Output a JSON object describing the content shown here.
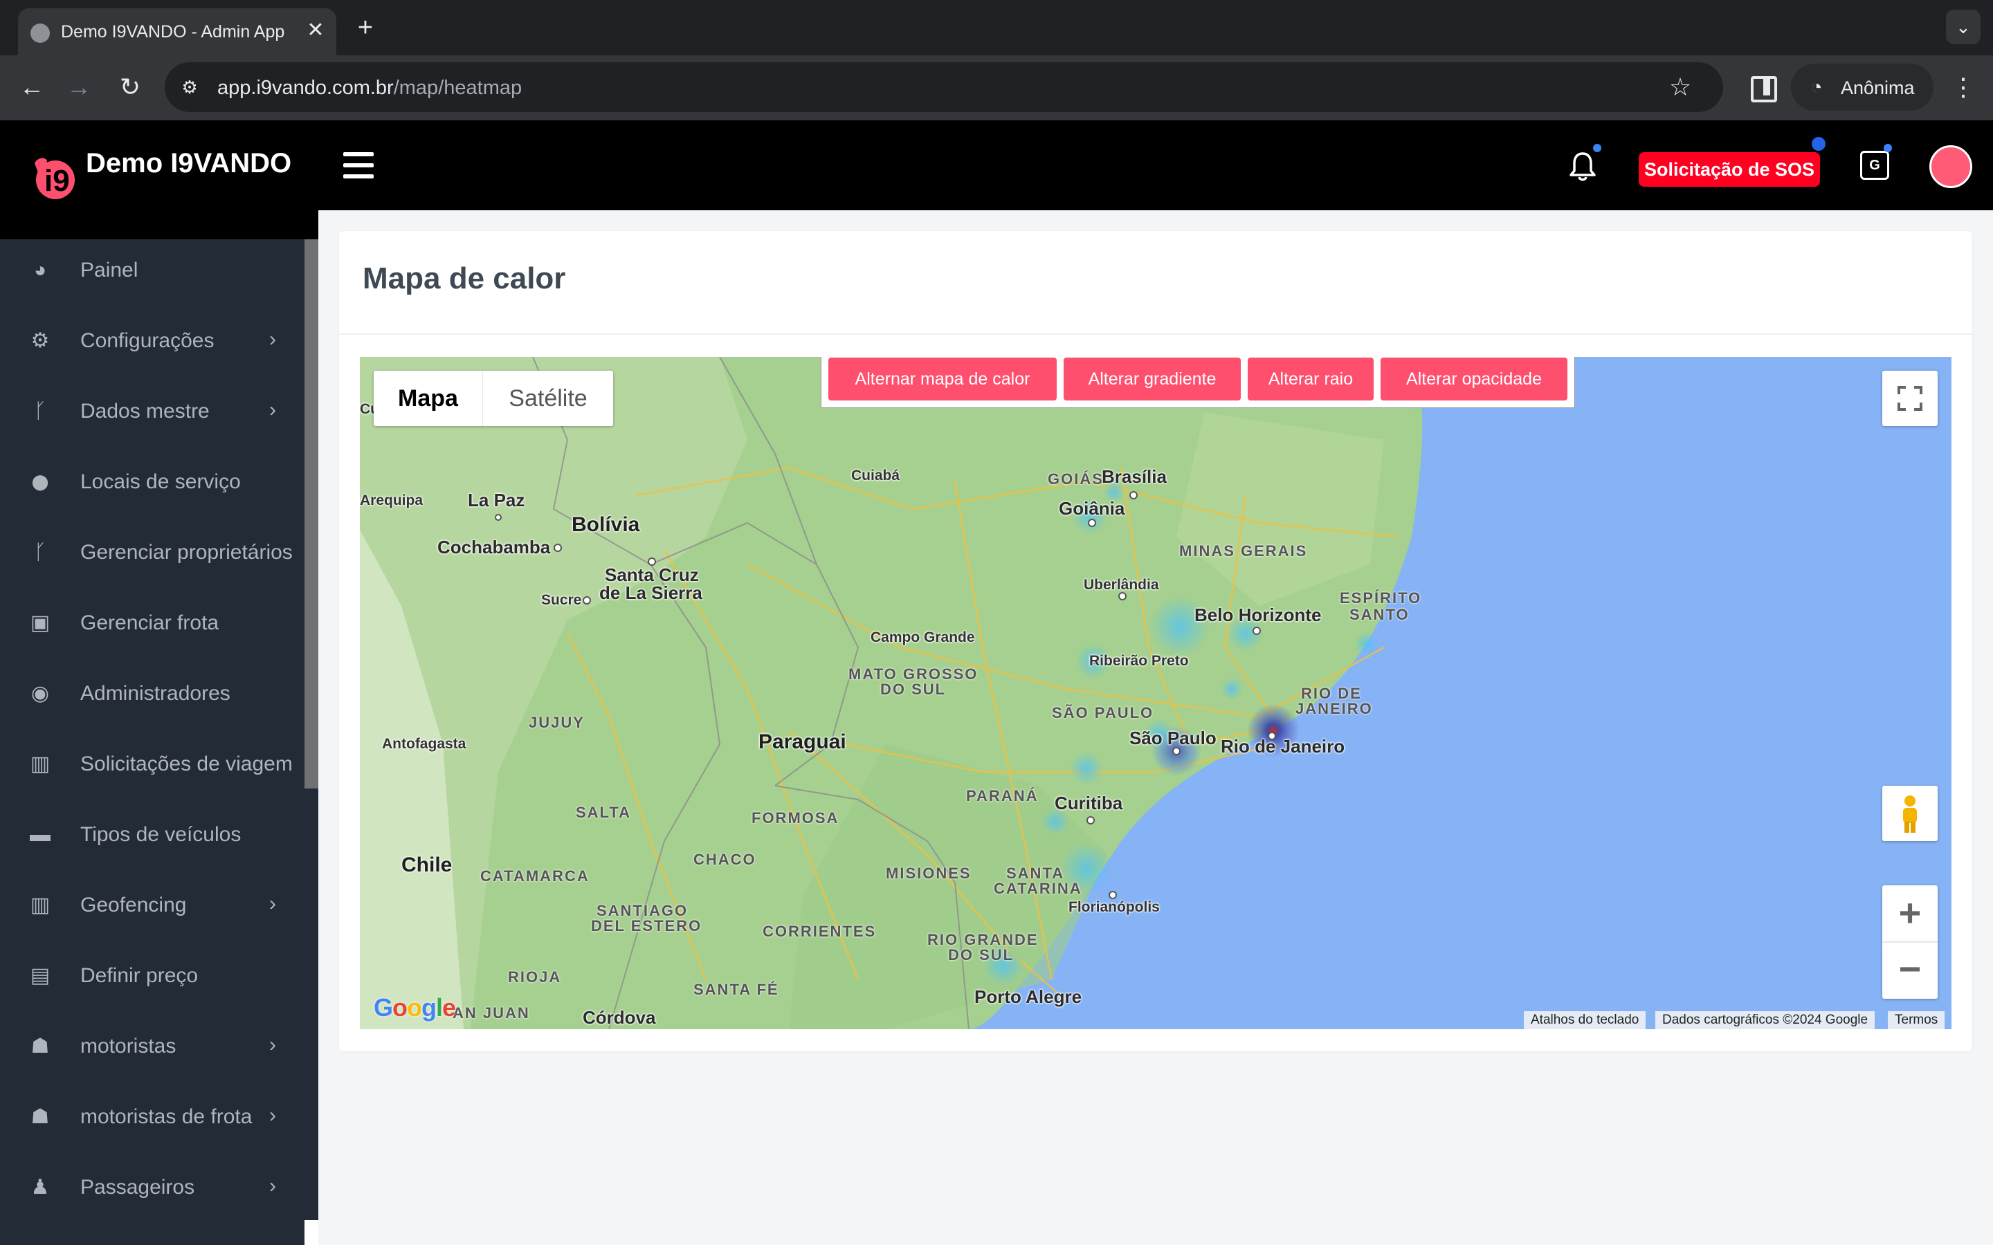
{
  "browser": {
    "tab_title": "Demo I9VANDO - Admin App",
    "tab_close": "✕",
    "new_tab": "+",
    "url_host": "app.i9vando.com.br",
    "url_path": "/map/heatmap",
    "profile_label": "Anônima",
    "tab_menu": "⌄"
  },
  "header": {
    "brand": "Demo I9VANDO",
    "sos_label": "Solicitação de SOS",
    "translate_glyph": "G",
    "accent_color": "#ff0021"
  },
  "sidebar": {
    "items": [
      {
        "label": "Painel",
        "icon": "dashboard-icon",
        "chevron": ""
      },
      {
        "label": "Configurações",
        "icon": "gears-icon",
        "chevron": "›"
      },
      {
        "label": "Dados mestre",
        "icon": "branch-icon",
        "chevron": "›"
      },
      {
        "label": "Locais de serviço",
        "icon": "map-pin-icon",
        "chevron": ""
      },
      {
        "label": "Gerenciar proprietários",
        "icon": "branch-icon",
        "chevron": ""
      },
      {
        "label": "Gerenciar frota",
        "icon": "bus-icon",
        "chevron": ""
      },
      {
        "label": "Administradores",
        "icon": "user-circle-icon",
        "chevron": ""
      },
      {
        "label": "Solicitações de viagem",
        "icon": "map-icon",
        "chevron": ""
      },
      {
        "label": "Tipos de veículos",
        "icon": "taxi-icon",
        "chevron": ""
      },
      {
        "label": "Geofencing",
        "icon": "map-icon",
        "chevron": "›"
      },
      {
        "label": "Definir preço",
        "icon": "money-icon",
        "chevron": ""
      },
      {
        "label": "motoristas",
        "icon": "users-icon",
        "chevron": "›"
      },
      {
        "label": "motoristas de frota",
        "icon": "users-icon",
        "chevron": "›"
      },
      {
        "label": "Passageiros",
        "icon": "user-icon",
        "chevron": "›"
      }
    ]
  },
  "page": {
    "title": "Mapa de calor"
  },
  "map": {
    "type_map": "Mapa",
    "type_satellite": "Satélite",
    "heat_buttons": [
      "Alternar mapa de calor",
      "Alterar gradiente",
      "Alterar raio",
      "Alterar opacidade"
    ],
    "zoom_in": "+",
    "zoom_out": "−",
    "attribution": {
      "shortcuts": "Atalhos do teclado",
      "data": "Dados cartográficos ©2024 Google",
      "terms": "Termos"
    },
    "labels": {
      "cu": "Cu",
      "arequipa": "Arequipa",
      "la_paz": "La Paz",
      "bolivia": "Bolívia",
      "cochabamba": "Cochabamba",
      "santa_cruz": "Santa Cruz",
      "de_la_sierra": "de La Sierra",
      "sucre": "Sucre",
      "cuiaba": "Cuiabá",
      "goias": "GOIÁS",
      "brasilia": "Brasília",
      "goiania": "Goiânia",
      "minas_gerais": "MINAS GERAIS",
      "uberlandia": "Uberlândia",
      "belo_horizonte": "Belo Horizonte",
      "espirito": "ESPÍRITO",
      "santo": "SANTO",
      "campo_grande": "Campo Grande",
      "mato_grosso": "MATO GROSSO",
      "do_sul": "DO SUL",
      "ribeirao": "Ribeirão Preto",
      "rio_de": "RIO DE",
      "janeiro_state": "JANEIRO",
      "sao_paulo_state": "SÃO PAULO",
      "antofagasta": "Antofagasta",
      "jujuy": "JUJUY",
      "paraguai": "Paraguai",
      "sao_paulo": "São Paulo",
      "rio_de_janeiro": "Rio de Janeiro",
      "parana": "PARANÁ",
      "curitiba": "Curitiba",
      "salta": "SALTA",
      "formosa": "FORMOSA",
      "chile": "Chile",
      "catamarca": "CATAMARCA",
      "chaco": "CHACO",
      "misiones": "MISIONES",
      "santa": "SANTA",
      "catarina": "CATARINA",
      "florianopolis": "Florianópolis",
      "santiago": "SANTIAGO",
      "del_estero": "DEL ESTERO",
      "corrientes": "CORRIENTES",
      "rio_grande": "RIO GRANDE",
      "do_sul_rs": "DO SUL",
      "rioja": "RIOJA",
      "santa_fe": "SANTA FÉ",
      "porto_alegre": "Porto Alegre",
      "san_juan": "AN JUAN",
      "cordoba": "Córdova"
    }
  }
}
